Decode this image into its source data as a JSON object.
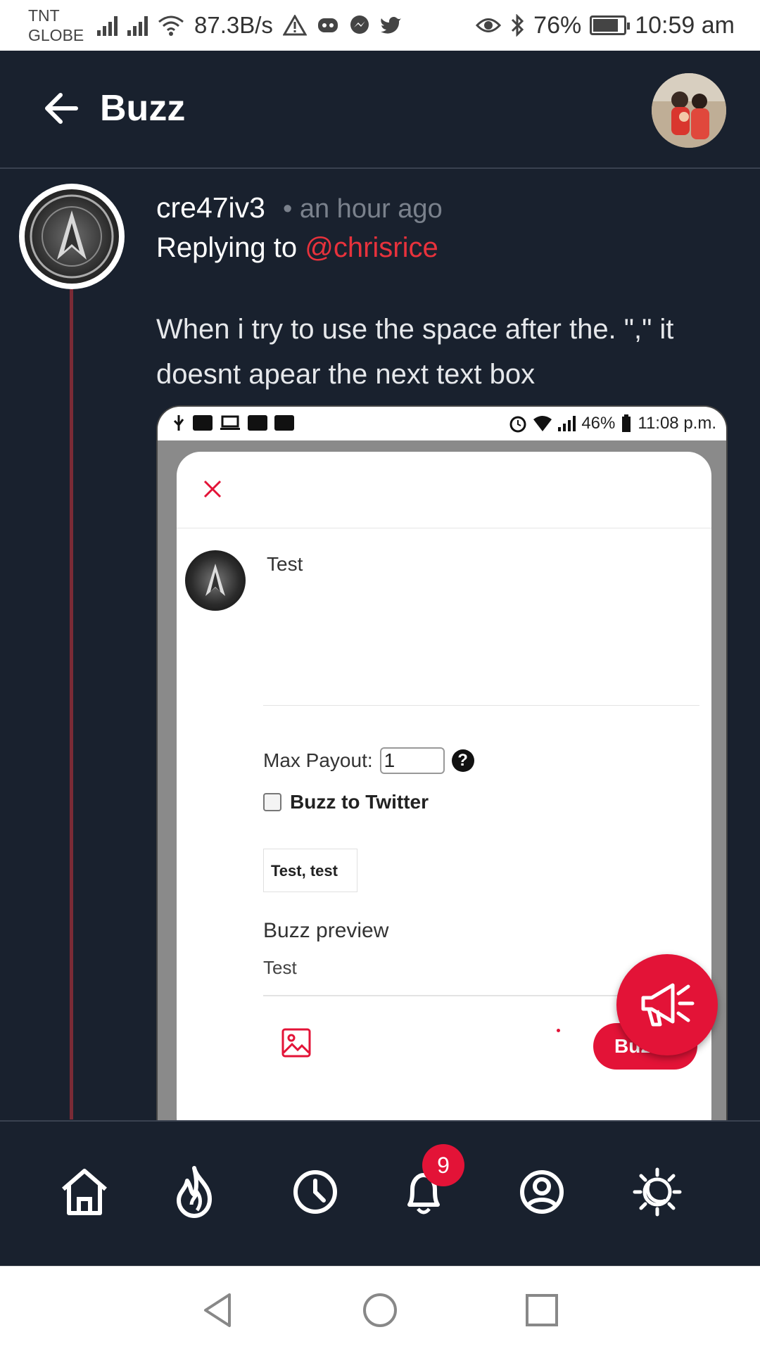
{
  "status_bar": {
    "carrier_line1": "TNT",
    "carrier_line2": "GLOBE",
    "network_speed": "87.3B/s",
    "battery": "76%",
    "battery_level": 0.76,
    "time": "10:59 am"
  },
  "header": {
    "title": "Buzz"
  },
  "post": {
    "username": "cre47iv3",
    "time_ago": "• an hour ago",
    "replying_prefix": "Replying to ",
    "mention": "@chrisrice",
    "body": "When i try to use the space after the. \",\" it doesnt apear the next text box"
  },
  "embed": {
    "status_battery": "46%",
    "status_time": "11:08 p.m.",
    "compose_text": "Test",
    "max_payout_label": "Max Payout:",
    "max_payout_value": "1",
    "help_symbol": "?",
    "buzz_to_twitter_label": "Buzz to Twitter",
    "tags": "Test, test",
    "preview_title": "Buzz preview",
    "preview_text": "Test",
    "buzz_button": "Buzz"
  },
  "bottom_nav": {
    "items": [
      "home-icon",
      "trending-icon",
      "latest-icon",
      "notifications-icon",
      "profile-icon",
      "theme-icon"
    ],
    "notifications_badge": "9"
  },
  "colors": {
    "background": "#19212e",
    "accent": "#e31337",
    "mention": "#e8323c",
    "muted": "#7a818c"
  }
}
